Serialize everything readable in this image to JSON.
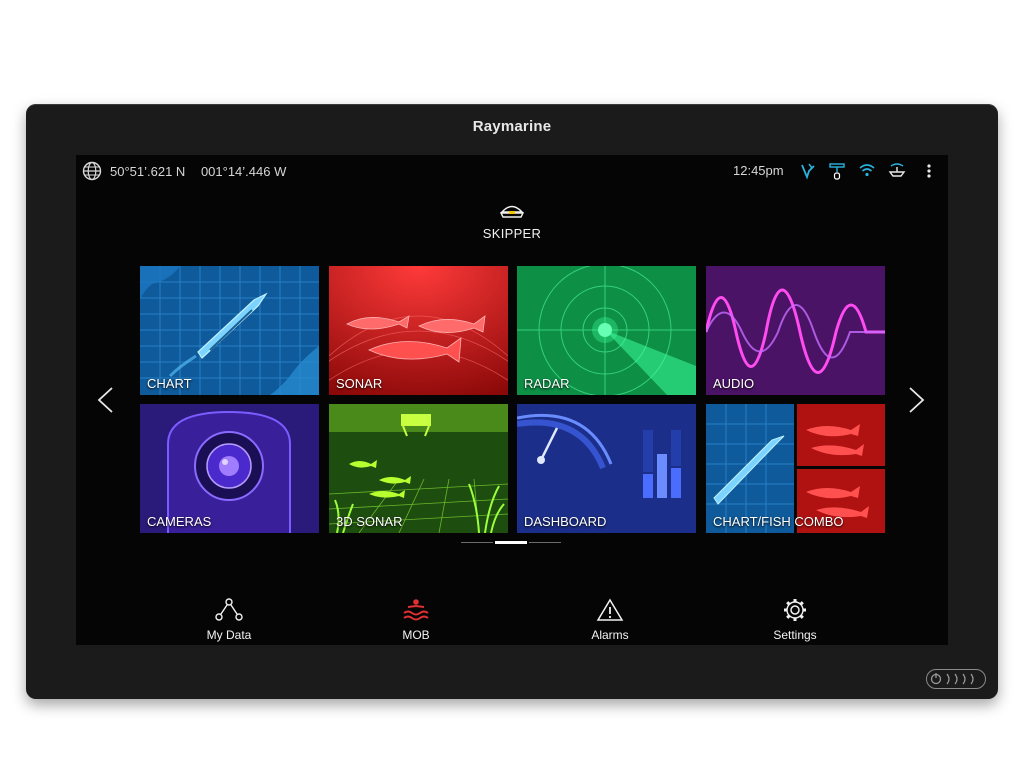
{
  "device": {
    "brand": "Raymarine"
  },
  "status": {
    "latitude": "50°51’.621 N",
    "longitude": "001°14’.446 W",
    "time": "12:45pm",
    "icons": [
      "globe-icon",
      "gps-signal-icon",
      "sonar-transducer-icon",
      "wifi-icon",
      "ais-target-icon",
      "more-menu-icon"
    ],
    "accent": "#2ab3e0"
  },
  "profile": {
    "label": "SKIPPER",
    "icon": "captain-hat-icon"
  },
  "tiles": [
    {
      "label": "CHART"
    },
    {
      "label": "SONAR"
    },
    {
      "label": "RADAR"
    },
    {
      "label": "AUDIO"
    },
    {
      "label": "CAMERAS"
    },
    {
      "label": "3D SONAR"
    },
    {
      "label": "DASHBOARD"
    },
    {
      "label": "CHART/FISH COMBO"
    }
  ],
  "pager": {
    "pages": 3,
    "active": 2
  },
  "nav": [
    {
      "label": "My Data",
      "icon": "network-icon"
    },
    {
      "label": "MOB",
      "icon": "man-overboard-icon",
      "color": "#e03030"
    },
    {
      "label": "Alarms",
      "icon": "warning-icon"
    },
    {
      "label": "Settings",
      "icon": "gear-icon"
    }
  ]
}
